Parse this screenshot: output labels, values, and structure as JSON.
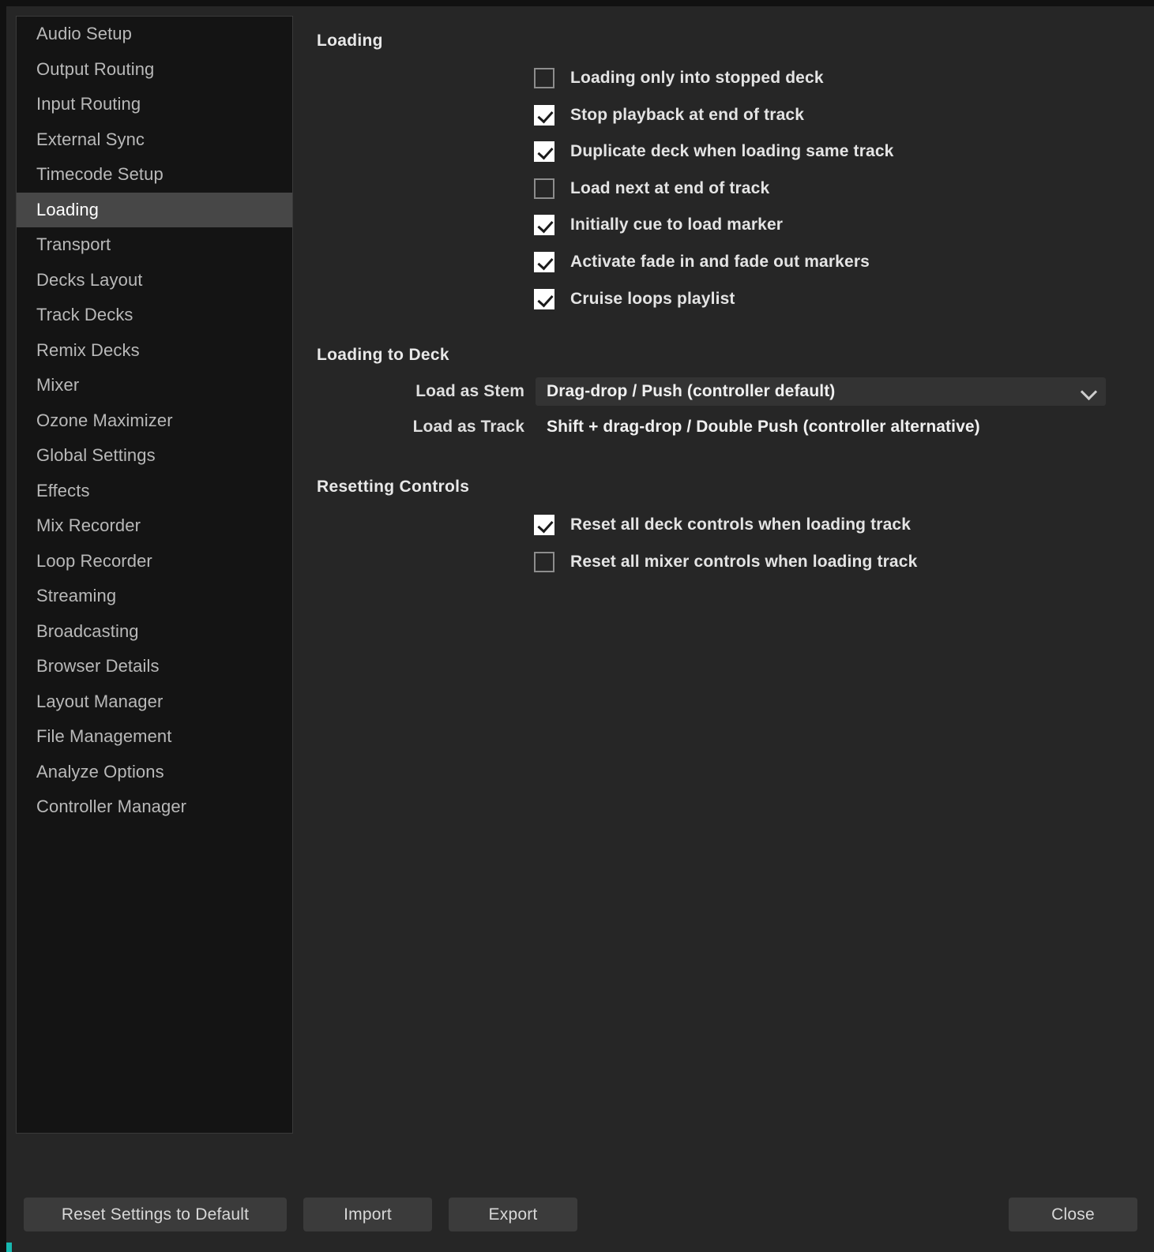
{
  "sidebar": {
    "items": [
      {
        "label": "Audio Setup",
        "selected": false
      },
      {
        "label": "Output Routing",
        "selected": false
      },
      {
        "label": "Input Routing",
        "selected": false
      },
      {
        "label": "External Sync",
        "selected": false
      },
      {
        "label": "Timecode Setup",
        "selected": false
      },
      {
        "label": "Loading",
        "selected": true
      },
      {
        "label": "Transport",
        "selected": false
      },
      {
        "label": "Decks Layout",
        "selected": false
      },
      {
        "label": "Track Decks",
        "selected": false
      },
      {
        "label": "Remix Decks",
        "selected": false
      },
      {
        "label": "Mixer",
        "selected": false
      },
      {
        "label": "Ozone Maximizer",
        "selected": false
      },
      {
        "label": "Global Settings",
        "selected": false
      },
      {
        "label": "Effects",
        "selected": false
      },
      {
        "label": "Mix Recorder",
        "selected": false
      },
      {
        "label": "Loop Recorder",
        "selected": false
      },
      {
        "label": "Streaming",
        "selected": false
      },
      {
        "label": "Broadcasting",
        "selected": false
      },
      {
        "label": "Browser Details",
        "selected": false
      },
      {
        "label": "Layout Manager",
        "selected": false
      },
      {
        "label": "File Management",
        "selected": false
      },
      {
        "label": "Analyze Options",
        "selected": false
      },
      {
        "label": "Controller Manager",
        "selected": false
      }
    ]
  },
  "sections": {
    "loading": {
      "heading": "Loading",
      "checkboxes": [
        {
          "label": "Loading only into stopped deck",
          "checked": false
        },
        {
          "label": "Stop playback at end of track",
          "checked": true
        },
        {
          "label": "Duplicate deck when loading same track",
          "checked": true
        },
        {
          "label": "Load next at end of track",
          "checked": false
        },
        {
          "label": "Initially cue to load marker",
          "checked": true
        },
        {
          "label": "Activate fade in and fade out markers",
          "checked": true
        },
        {
          "label": "Cruise loops playlist",
          "checked": true
        }
      ]
    },
    "loading_to_deck": {
      "heading": "Loading to Deck",
      "load_as_stem": {
        "label": "Load as Stem",
        "value": "Drag-drop / Push (controller default)",
        "icon": "chevron-down-icon"
      },
      "load_as_track": {
        "label": "Load as Track",
        "value": "Shift + drag-drop / Double Push (controller alternative)"
      }
    },
    "resetting_controls": {
      "heading": "Resetting Controls",
      "checkboxes": [
        {
          "label": "Reset all deck controls when loading track",
          "checked": true
        },
        {
          "label": "Reset all mixer controls when loading track",
          "checked": false
        }
      ]
    }
  },
  "footer": {
    "reset_label": "Reset Settings to Default",
    "import_label": "Import",
    "export_label": "Export",
    "close_label": "Close"
  },
  "colors": {
    "window_bg": "#262626",
    "sidebar_bg": "#141414",
    "selection": "#474747",
    "accent": "#17b8b0",
    "button_bg": "#3b3b3b"
  }
}
